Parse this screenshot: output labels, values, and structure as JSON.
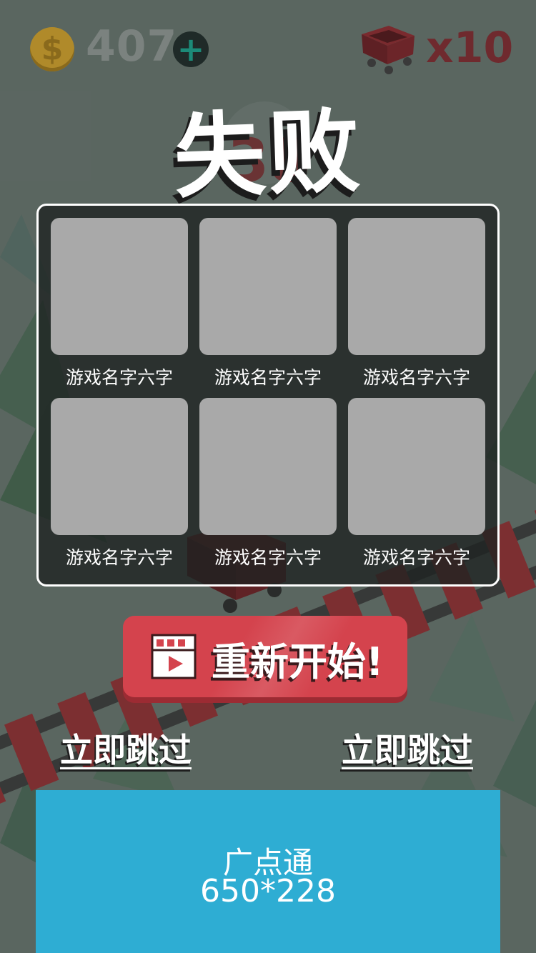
{
  "hud": {
    "coin_symbol": "$",
    "coin_count": "407",
    "add_symbol": "+",
    "cart_count": "x10"
  },
  "result": {
    "title": "失败",
    "ghost_score": "38"
  },
  "games": [
    {
      "name": "游戏名字六字"
    },
    {
      "name": "游戏名字六字"
    },
    {
      "name": "游戏名字六字"
    },
    {
      "name": "游戏名字六字"
    },
    {
      "name": "游戏名字六字"
    },
    {
      "name": "游戏名字六字"
    }
  ],
  "restart": {
    "label": "重新开始!"
  },
  "skip": {
    "left_label": "立即跳过",
    "right_label": "立即跳过"
  },
  "ad": {
    "line1": "广点通",
    "line2": "650*228"
  },
  "colors": {
    "restart_red": "#d4434d",
    "ad_blue": "#2eadd3",
    "tile_gray": "#a9a9a9"
  }
}
